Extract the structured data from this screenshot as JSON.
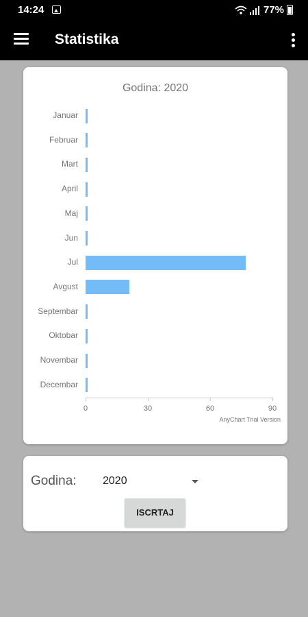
{
  "status_bar": {
    "time": "14:24",
    "battery": "77%"
  },
  "app_bar": {
    "title": "Statistika"
  },
  "chart_data": {
    "type": "bar",
    "orientation": "horizontal",
    "title": "Godina: 2020",
    "categories": [
      "Januar",
      "Februar",
      "Mart",
      "April",
      "Maj",
      "Jun",
      "Jul",
      "Avgust",
      "Septembar",
      "Oktobar",
      "Novembar",
      "Decembar"
    ],
    "values": [
      0,
      0,
      0,
      0,
      0,
      0,
      77,
      21,
      0,
      0,
      0,
      0
    ],
    "xlim": [
      0,
      90
    ],
    "ticks": [
      "0",
      "30",
      "60",
      "90"
    ],
    "bar_color": "#64b5f6",
    "footer": "AnyChart Trial Version"
  },
  "form": {
    "label": "Godina:",
    "selected_year": "2020",
    "button_label": "ISCRTAJ"
  }
}
